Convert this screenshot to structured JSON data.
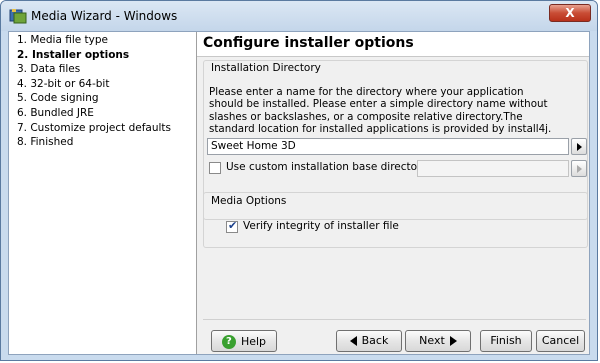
{
  "window": {
    "title": "Media Wizard - Windows",
    "close_label": "X"
  },
  "sidebar": {
    "steps": [
      {
        "label": "1. Media file type"
      },
      {
        "label": "2. Installer options",
        "active": true
      },
      {
        "label": "3. Data files"
      },
      {
        "label": "4. 32-bit or 64-bit"
      },
      {
        "label": "5. Code signing"
      },
      {
        "label": "6. Bundled JRE"
      },
      {
        "label": "7. Customize project defaults"
      },
      {
        "label": "8. Finished"
      }
    ]
  },
  "header": {
    "title": "Configure installer options"
  },
  "installation_directory": {
    "legend": "Installation Directory",
    "description": "Please enter a name for the directory where your application should be installed. Please enter a simple directory name without slashes or backslashes, or a composite relative directory.The standard location for installed applications is provided by install4j.",
    "directory_value": "Sweet Home 3D",
    "custom_base_label": "Use custom installation base directory:",
    "custom_base_checked": false,
    "custom_base_value": ""
  },
  "media_options": {
    "legend": "Media Options",
    "verify_label": "Verify integrity of installer file",
    "verify_checked": true
  },
  "footer": {
    "help_label": "Help",
    "back_label": "Back",
    "next_label": "Next",
    "finish_label": "Finish",
    "cancel_label": "Cancel"
  }
}
